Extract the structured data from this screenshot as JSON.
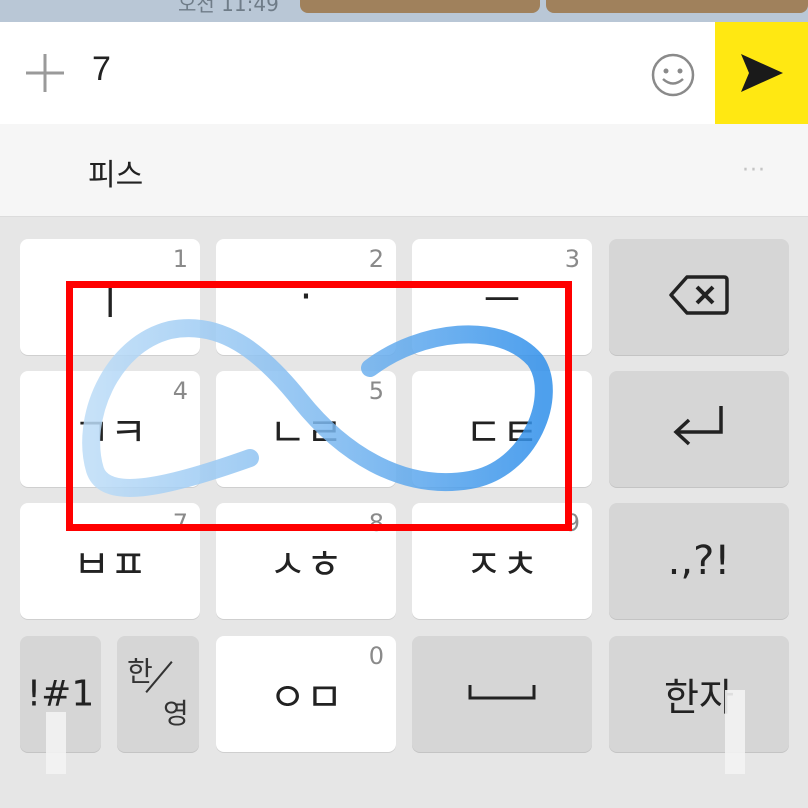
{
  "status": {
    "time_text": "오전 11:49"
  },
  "input_bar": {
    "text_value": "7",
    "plus_icon": "plus-icon",
    "emoji_icon": "smiley-icon",
    "send_icon": "send-arrow-icon",
    "send_color": "#FFE812"
  },
  "suggestion_bar": {
    "word": "피스",
    "more": "···"
  },
  "keyboard": {
    "row1": [
      {
        "label": "ㅣ",
        "num": "1"
      },
      {
        "label": "·",
        "num": "2"
      },
      {
        "label": "ㅡ",
        "num": "3"
      }
    ],
    "row2": [
      {
        "label": "ㄱㅋ",
        "num": "4"
      },
      {
        "label": "ㄴㄹ",
        "num": "5"
      },
      {
        "label": "ㄷㅌ",
        "num": "6"
      }
    ],
    "row3": [
      {
        "label": "ㅂㅍ",
        "num": "7"
      },
      {
        "label": "ㅅㅎ",
        "num": "8"
      },
      {
        "label": "ㅈㅊ",
        "num": "9"
      }
    ],
    "row4": {
      "symbols": "!#1",
      "lang_top": "한",
      "lang_bottom": "영",
      "om": {
        "label": "ㅇㅁ",
        "num": "0"
      },
      "hanja": "한자"
    },
    "side": {
      "backspace_icon": "backspace-icon",
      "enter_icon": "enter-icon",
      "punct": ".,?!"
    }
  },
  "annotation": {
    "highlight_color": "#FF0000",
    "gesture_color": "#2F8FEA"
  }
}
